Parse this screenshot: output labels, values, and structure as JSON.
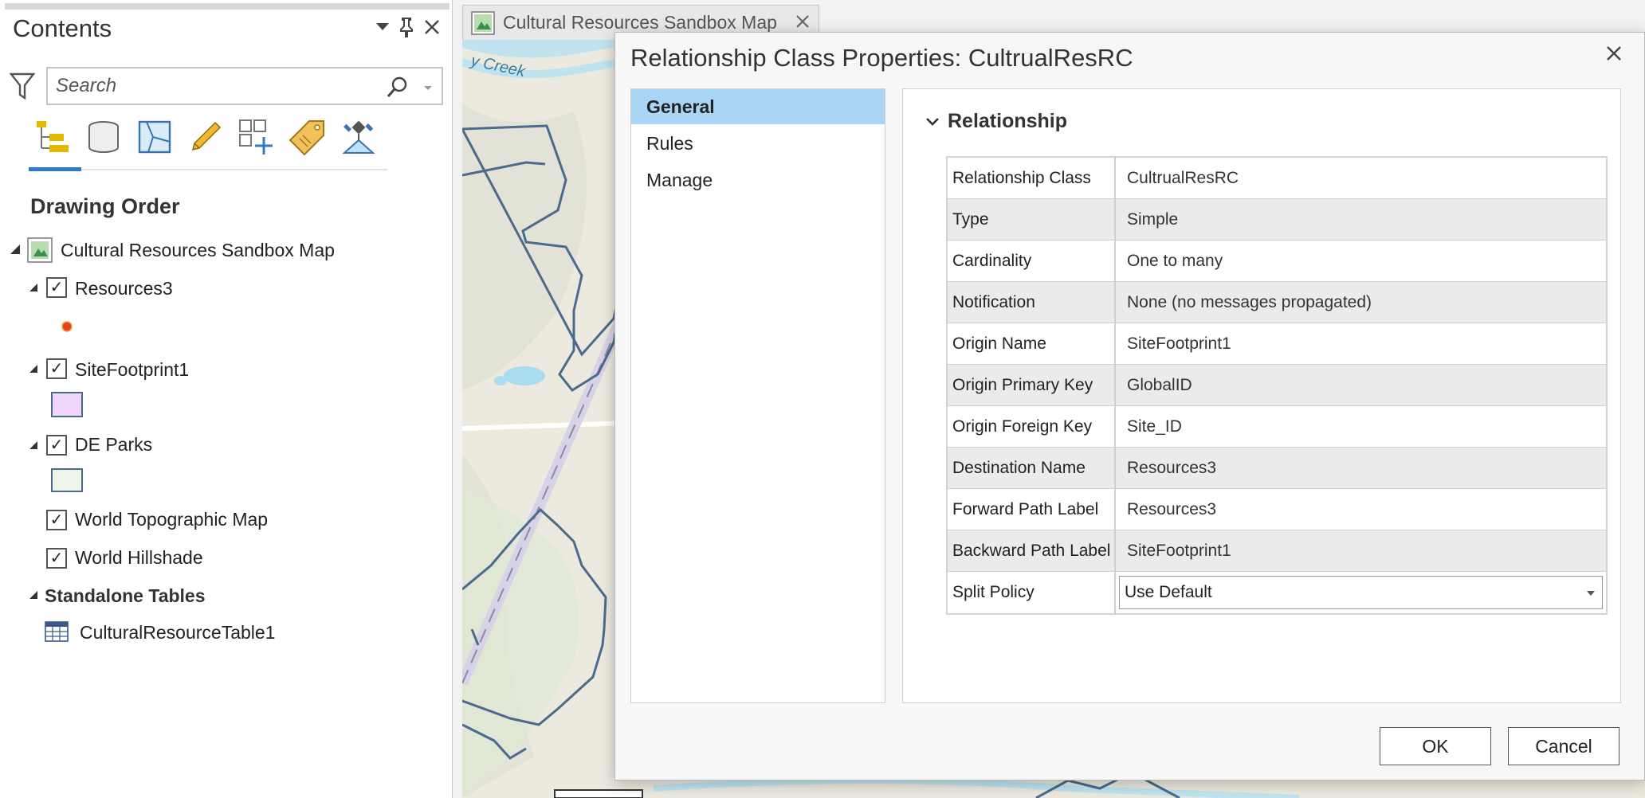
{
  "contents": {
    "title": "Contents",
    "search_placeholder": "Search",
    "toolbar": [
      "list-by-drawing-order-icon",
      "list-by-data-source-icon",
      "list-by-selection-icon",
      "list-by-editing-icon",
      "list-by-snapping-icon",
      "list-by-labeling-icon",
      "list-by-perspective-imagery-icon"
    ],
    "section_title": "Drawing Order",
    "map_name": "Cultural Resources Sandbox Map",
    "layers": [
      {
        "name": "Resources3",
        "checked": true
      },
      {
        "name": "SiteFootprint1",
        "checked": true
      },
      {
        "name": "DE Parks",
        "checked": true
      },
      {
        "name": "World Topographic Map",
        "checked": true
      },
      {
        "name": "World Hillshade",
        "checked": true
      }
    ],
    "standalone_title": "Standalone Tables",
    "standalone_table": "CulturalResourceTable1",
    "colors": {
      "point": "#e8421c",
      "footprint_fill": "#f0d6fa",
      "parks_fill": "#eef7ea",
      "symbol_border": "#4a6b8c"
    }
  },
  "map_tab": {
    "label": "Cultural Resources Sandbox Map"
  },
  "map": {
    "label_creek": "y Creek"
  },
  "dialog": {
    "title": "Relationship Class Properties: CultrualResRC",
    "nav": [
      "General",
      "Rules",
      "Manage"
    ],
    "group": "Relationship",
    "properties": [
      {
        "key": "Relationship Class",
        "value": "CultrualResRC"
      },
      {
        "key": "Type",
        "value": "Simple"
      },
      {
        "key": "Cardinality",
        "value": "One to many"
      },
      {
        "key": "Notification",
        "value": "None (no messages propagated)"
      },
      {
        "key": "Origin Name",
        "value": "SiteFootprint1"
      },
      {
        "key": "Origin Primary Key",
        "value": "GlobalID"
      },
      {
        "key": "Origin Foreign Key",
        "value": "Site_ID"
      },
      {
        "key": "Destination Name",
        "value": "Resources3"
      },
      {
        "key": "Forward Path Label",
        "value": "Resources3"
      },
      {
        "key": "Backward Path Label",
        "value": "SiteFootprint1"
      }
    ],
    "split_policy": {
      "key": "Split Policy",
      "value": "Use Default"
    },
    "ok_label": "OK",
    "cancel_label": "Cancel",
    "colors": {
      "nav_selected": "#a9d6f4"
    }
  }
}
